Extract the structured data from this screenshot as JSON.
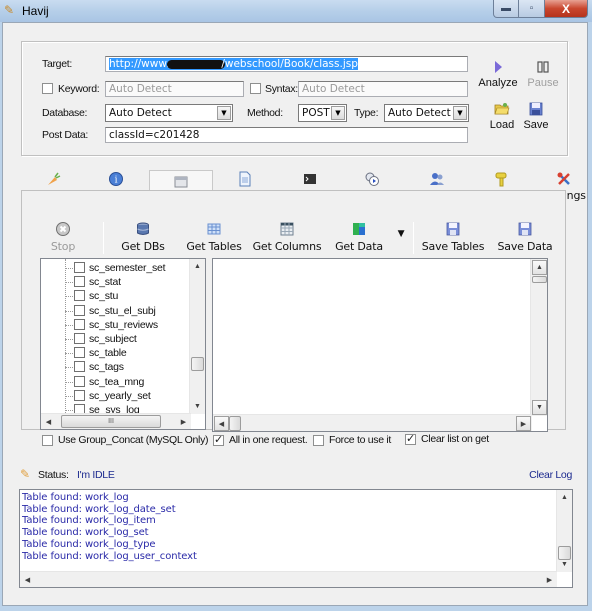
{
  "window": {
    "title": "Havij",
    "app_icon": "carrot-icon",
    "buttons": {
      "minimize": "—",
      "maximize": "□",
      "close": "X"
    }
  },
  "target_form": {
    "target_label": "Target:",
    "target_value_prefix": "http://www.",
    "target_value_suffix": "/webschool/Book/class.jsp",
    "keyword_label": "Keyword:",
    "keyword_checked": false,
    "keyword_value": "Auto Detect",
    "syntax_label": "Syntax:",
    "syntax_checked": false,
    "syntax_value": "Auto Detect",
    "database_label": "Database:",
    "database_value": "Auto Detect",
    "method_label": "Method:",
    "method_value": "POST",
    "type_label": "Type:",
    "type_value": "Auto Detect",
    "post_data_label": "Post Data:",
    "post_data_value": "classId=c201428"
  },
  "actions": {
    "analyze": "Analyze",
    "pause": "Pause",
    "load": "Load",
    "save": "Save"
  },
  "tabs": [
    {
      "label": "About",
      "icon": "carrot-icon",
      "active": false,
      "disabled": false
    },
    {
      "label": "Info",
      "icon": "info-icon",
      "active": false,
      "disabled": false
    },
    {
      "label": "Tables",
      "icon": "table-icon",
      "active": true,
      "disabled": false
    },
    {
      "label": "Read Files",
      "icon": "file-icon",
      "active": false,
      "disabled": false
    },
    {
      "label": "Cmd Shell",
      "icon": "terminal-icon",
      "active": false,
      "disabled": true
    },
    {
      "label": "Query",
      "icon": "query-icon",
      "active": false,
      "disabled": false
    },
    {
      "label": "Find Admin",
      "icon": "users-icon",
      "active": false,
      "disabled": false
    },
    {
      "label": "MD5",
      "icon": "key-icon",
      "active": false,
      "disabled": false
    },
    {
      "label": "Settings",
      "icon": "tools-icon",
      "active": false,
      "disabled": false
    }
  ],
  "tables_toolbar": {
    "stop": "Stop",
    "get_dbs": "Get DBs",
    "get_tables": "Get Tables",
    "get_columns": "Get Columns",
    "get_data": "Get Data",
    "save_tables": "Save Tables",
    "save_data": "Save Data"
  },
  "table_tree": {
    "items": [
      "sc_semester_set",
      "sc_stat",
      "sc_stu",
      "sc_stu_el_subj",
      "sc_stu_reviews",
      "sc_subject",
      "sc_table",
      "sc_tags",
      "sc_tea_mng",
      "sc_yearly_set",
      "se_sys_log"
    ],
    "hscroll_grip": "III"
  },
  "options": {
    "use_group_concat": {
      "label": "Use Group_Concat (MySQL Only)",
      "checked": false
    },
    "all_in_one": {
      "label": "All in one request.",
      "checked": true
    },
    "force_to_use": {
      "label": "Force to use it",
      "checked": false
    },
    "clear_list": {
      "label": "Clear list on get",
      "checked": true
    }
  },
  "status": {
    "label": "Status:",
    "value": "I'm IDLE",
    "clear_log": "Clear Log"
  },
  "log": {
    "lines": [
      "Table found: work_log",
      "Table found: work_log_date_set",
      "Table found: work_log_item",
      "Table found: work_log_set",
      "Table found: work_log_type",
      "Table found: work_log_user_context"
    ]
  }
}
